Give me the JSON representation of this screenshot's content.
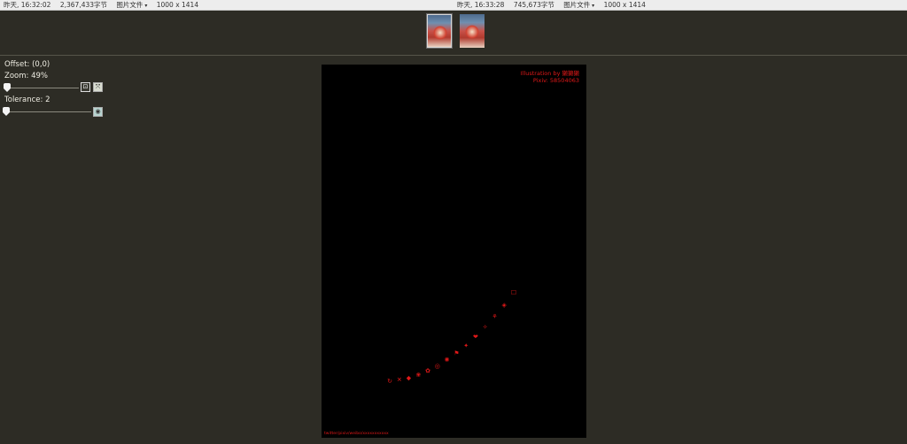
{
  "left_file": {
    "date": "昨天, 16:32:02",
    "size": "2,367,433字节",
    "type": "图片文件",
    "dims": "1000 x 1414"
  },
  "right_file": {
    "date": "昨天, 16:33:28",
    "size": "745,673字节",
    "type": "图片文件",
    "dims": "1000 x 1414"
  },
  "panel": {
    "offset": "Offset: (0,0)",
    "zoom": "Zoom: 49%",
    "zoom_value": 0.49,
    "tolerance": "Tolerance: 2",
    "tolerance_value": 2
  },
  "overlay": {
    "line1": "Illustration by 獭獭獭",
    "line2": "Pixiv: 58504063",
    "bottom": "twitter/pixiv/weibo/xxxxxxxxxxx"
  },
  "diff_marks": [
    "↻",
    "✕",
    "◆",
    "❀",
    "✿",
    "◎",
    "✺",
    "⚑",
    "✦",
    "❤",
    "✧",
    "⚘",
    "◈",
    "☐"
  ],
  "colors": {
    "background": "#2d2c25",
    "diff": "#e01818",
    "topbar": "#ededed"
  }
}
